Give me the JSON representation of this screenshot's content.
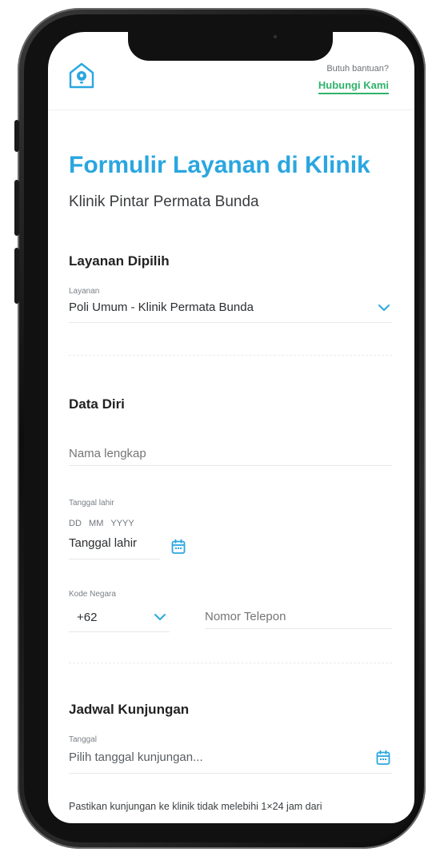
{
  "header": {
    "help_text": "Butuh bantuan?",
    "help_link": "Hubungi Kami"
  },
  "form": {
    "title": "Formulir Layanan di Klinik",
    "subtitle": "Klinik Pintar Permata Bunda",
    "service_section": {
      "heading": "Layanan Dipilih",
      "label": "Layanan",
      "value": "Poli Umum - Klinik Permata Bunda"
    },
    "personal_section": {
      "heading": "Data Diri",
      "name_placeholder": "Nama lengkap",
      "dob_label": "Tanggal lahir",
      "dob_format": "DD   MM   YYYY",
      "dob_placeholder": "Tanggal lahir",
      "country_code_label": "Kode Negara",
      "country_code_value": "+62",
      "phone_placeholder": "Nomor Telepon"
    },
    "schedule_section": {
      "heading": "Jadwal Kunjungan",
      "date_label": "Tanggal",
      "date_placeholder": "Pilih tanggal kunjungan...",
      "note": "Pastikan kunjungan ke klinik tidak melebihi 1×24 jam dari"
    }
  },
  "colors": {
    "accent_blue": "#2aa6e0",
    "link_green": "#2fb36b"
  },
  "icons": [
    "clinic-logo-icon",
    "chevron-down-icon",
    "calendar-icon"
  ]
}
